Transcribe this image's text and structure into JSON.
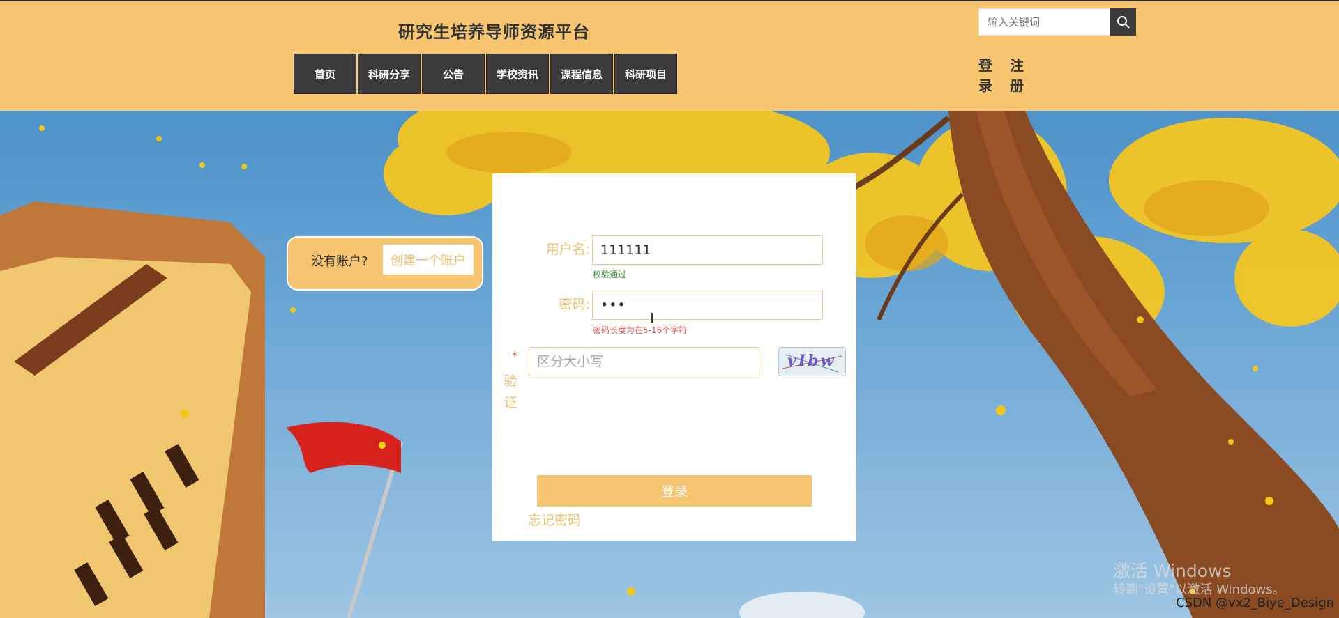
{
  "header": {
    "title": "研究生培养导师资源平台",
    "nav": [
      "首页",
      "科研分享",
      "公告",
      "学校资讯",
      "课程信息",
      "科研项目"
    ],
    "search_placeholder": "输入关键词",
    "login_label": "登录",
    "register_label": "注册"
  },
  "no_account": {
    "text": "没有账户?",
    "create_label": "创建一个账户"
  },
  "form": {
    "username_label": "用户名:",
    "username_value": "111111",
    "username_msg": "校验通过",
    "password_label": "密码:",
    "password_value": "•••",
    "password_msg": "密码长度为在5-16个字符",
    "captcha_required_mark": "*",
    "captcha_label_1": "验",
    "captcha_label_2": "证",
    "captcha_placeholder": "区分大小写",
    "captcha_text": "vIbw",
    "login_button": "登录",
    "forgot_link": "忘记密码"
  },
  "watermark": {
    "line1": "激活 Windows",
    "line2": "转到\"设置\"以激活 Windows。",
    "credit": "CSDN @vx2_Biye_Design"
  },
  "colors": {
    "header_bg": "#f7c570",
    "nav_bg": "#3b3b3b",
    "accent": "#f0c070",
    "ok": "#3a8f3a",
    "error": "#d9534f"
  }
}
